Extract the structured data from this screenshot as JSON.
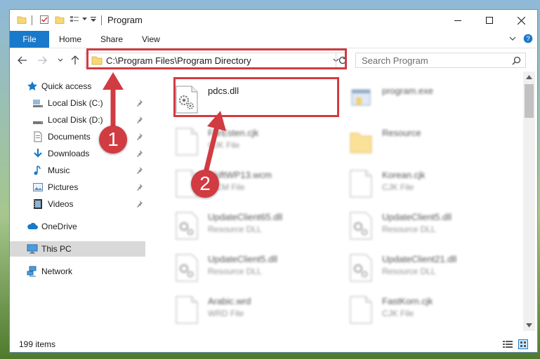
{
  "window": {
    "title": "Program"
  },
  "ribbon": {
    "tabs": [
      {
        "label": "File"
      },
      {
        "label": "Home"
      },
      {
        "label": "Share"
      },
      {
        "label": "View"
      }
    ]
  },
  "address": {
    "path": "C:\\Program Files\\Program Directory",
    "search_placeholder": "Search Program"
  },
  "nav": {
    "items": [
      {
        "label": "Quick access",
        "icon": "star-icon"
      },
      {
        "label": "Local Disk (C:)",
        "icon": "drive-icon",
        "pinned": true
      },
      {
        "label": "Local Disk (D:)",
        "icon": "drive-icon",
        "pinned": true
      },
      {
        "label": "Documents",
        "icon": "documents-icon",
        "pinned": true
      },
      {
        "label": "Downloads",
        "icon": "download-icon",
        "pinned": true
      },
      {
        "label": "Music",
        "icon": "music-icon",
        "pinned": true
      },
      {
        "label": "Pictures",
        "icon": "pictures-icon",
        "pinned": true
      },
      {
        "label": "Videos",
        "icon": "video-icon",
        "pinned": true
      },
      {
        "label": "OneDrive",
        "icon": "cloud-icon"
      },
      {
        "label": "This PC",
        "icon": "computer-icon"
      },
      {
        "label": "Network",
        "icon": "network-icon"
      }
    ]
  },
  "files": [
    {
      "name": "pdcs.dll",
      "type": ""
    },
    {
      "name": "program.exe",
      "type": ""
    },
    {
      "name": "FarEsten.cjk",
      "type": "CJK File"
    },
    {
      "name": "Resource",
      "type": ""
    },
    {
      "name": "SkiftWP13.wcm",
      "type": "WCM File"
    },
    {
      "name": "Korean.cjk",
      "type": "CJK File"
    },
    {
      "name": "UpdateClient65.dll",
      "type": "Resource DLL"
    },
    {
      "name": "UpdateClient5.dll",
      "type": "Resource DLL"
    },
    {
      "name": "UpdateClient5.dll",
      "type": "Resource DLL"
    },
    {
      "name": "UpdateClient21.dll",
      "type": "Resource DLL"
    },
    {
      "name": "Arabic.wrd",
      "type": "WRD File"
    },
    {
      "name": "FastKorn.cjk",
      "type": "CJK File"
    }
  ],
  "status": {
    "item_count": "199 items"
  },
  "annotations": {
    "step1": "1",
    "step2": "2"
  },
  "colors": {
    "accent": "#1979ca",
    "highlight": "#d13b42",
    "selected": "#d9d9d9"
  }
}
